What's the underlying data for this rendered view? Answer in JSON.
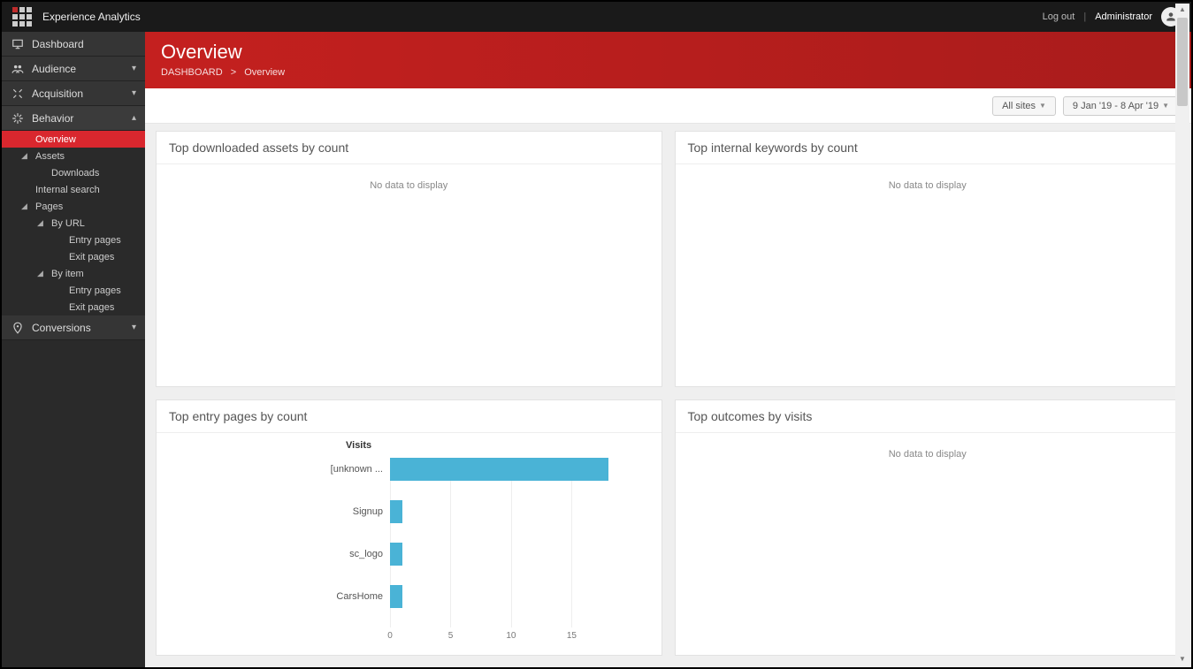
{
  "app": {
    "title": "Experience Analytics",
    "logout": "Log out",
    "user": "Administrator"
  },
  "sidebar": {
    "items": [
      {
        "label": "Dashboard"
      },
      {
        "label": "Audience"
      },
      {
        "label": "Acquisition"
      },
      {
        "label": "Behavior"
      },
      {
        "label": "Conversions"
      }
    ],
    "behavior_children": {
      "overview": "Overview",
      "assets": "Assets",
      "downloads": "Downloads",
      "internal_search": "Internal search",
      "pages": "Pages",
      "by_url": "By URL",
      "by_item": "By item",
      "entry_pages": "Entry pages",
      "exit_pages": "Exit pages"
    }
  },
  "header": {
    "title": "Overview",
    "breadcrumb_root": "DASHBOARD",
    "breadcrumb_sep": ">",
    "breadcrumb_current": "Overview"
  },
  "toolbar": {
    "sites_label": "All sites",
    "date_label": "9 Jan '19 - 8 Apr '19"
  },
  "panels": {
    "top_downloaded_assets": {
      "title": "Top downloaded assets by count",
      "empty": "No data to display"
    },
    "top_internal_keywords": {
      "title": "Top internal keywords by count",
      "empty": "No data to display"
    },
    "top_entry_pages": {
      "title": "Top entry pages by count"
    },
    "top_outcomes": {
      "title": "Top outcomes by visits",
      "empty": "No data to display"
    }
  },
  "chart_data": {
    "type": "bar",
    "orientation": "horizontal",
    "ylabel": "Visits",
    "categories": [
      "[unknown ...",
      "Signup",
      "sc_logo",
      "CarsHome"
    ],
    "values": [
      18,
      1,
      1,
      1
    ],
    "xlim": [
      0,
      18
    ],
    "xticks": [
      0,
      5,
      10,
      15
    ],
    "bar_color": "#4ab3d6"
  }
}
